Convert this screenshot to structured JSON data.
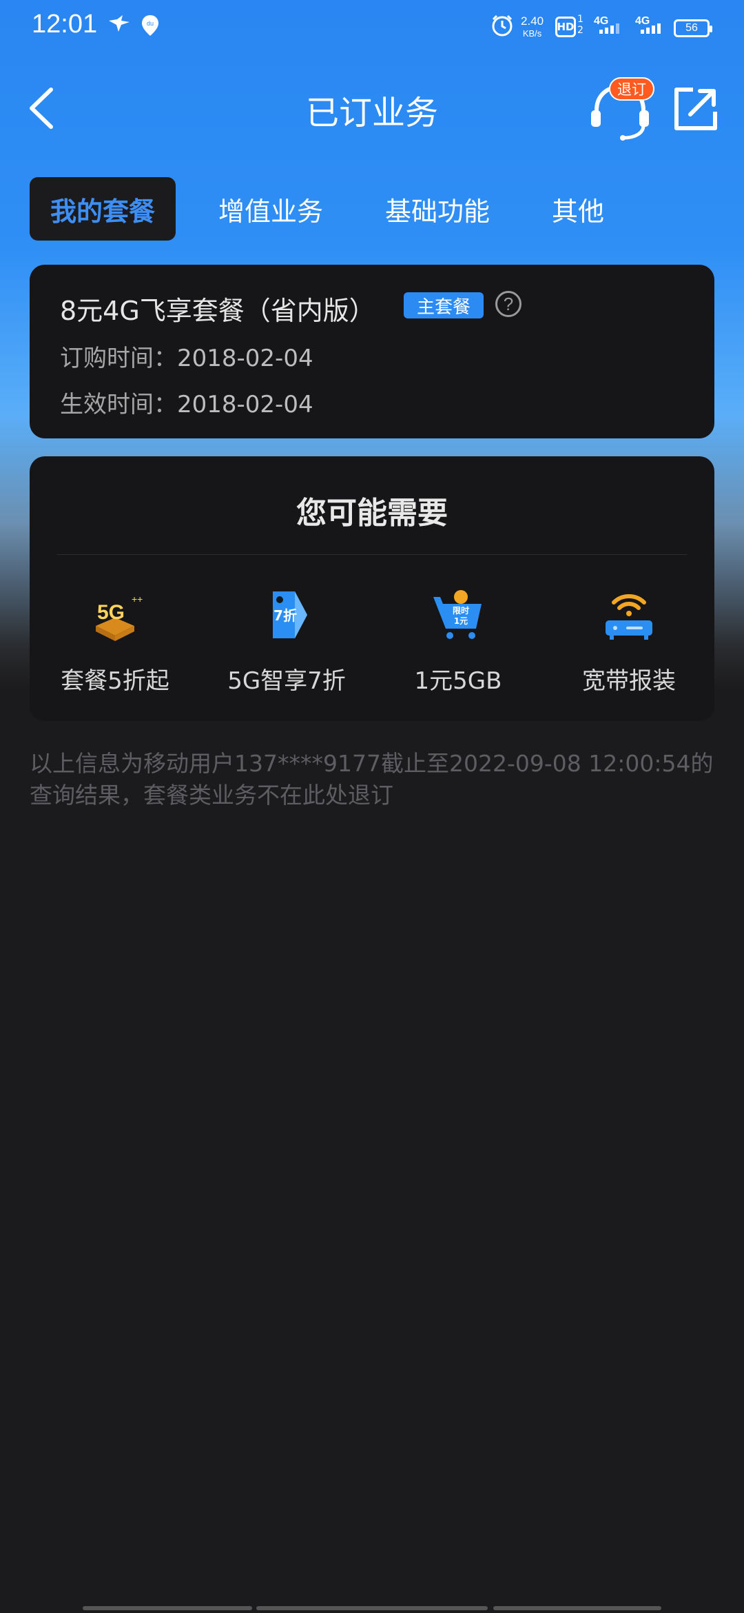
{
  "status_bar": {
    "time": "12:01",
    "net_speed_value": "2.40",
    "net_speed_unit": "KB/s",
    "hd_label": "HD",
    "sim_numbers": "1 2",
    "sim1_network": "4G",
    "sim2_network": "4G",
    "battery": "56"
  },
  "header": {
    "title": "已订业务",
    "unsubscribe_badge": "退订"
  },
  "tabs": [
    {
      "label": "我的套餐"
    },
    {
      "label": "增值业务"
    },
    {
      "label": "基础功能"
    },
    {
      "label": "其他"
    }
  ],
  "plan": {
    "name": "8元4G飞享套餐（省内版）",
    "badge": "主套餐",
    "help_symbol": "?",
    "order_time_label": "订购时间：",
    "order_time_value": "2018-02-04",
    "effective_time_label": "生效时间：",
    "effective_time_value": "2018-02-04"
  },
  "recommend": {
    "title": "您可能需要",
    "items": [
      {
        "label": "套餐5折起",
        "icon": "5g-gift-icon"
      },
      {
        "label": "5G智享7折",
        "icon": "discount-tag-icon",
        "icon_text": "7折"
      },
      {
        "label": "1元5GB",
        "icon": "shopping-cart-icon",
        "icon_text_1": "限时",
        "icon_text_2": "1元"
      },
      {
        "label": "宽带报装",
        "icon": "wifi-router-icon"
      }
    ]
  },
  "footnote": "以上信息为移动用户137****9177截止至2022-09-08 12:00:54的查询结果，套餐类业务不在此处退订",
  "colors": {
    "accent": "#2c8af3",
    "header_blue": "#2f8ff5",
    "badge_orange": "#ff5a1f",
    "background": "#1b1b1d",
    "card": "#161618"
  }
}
